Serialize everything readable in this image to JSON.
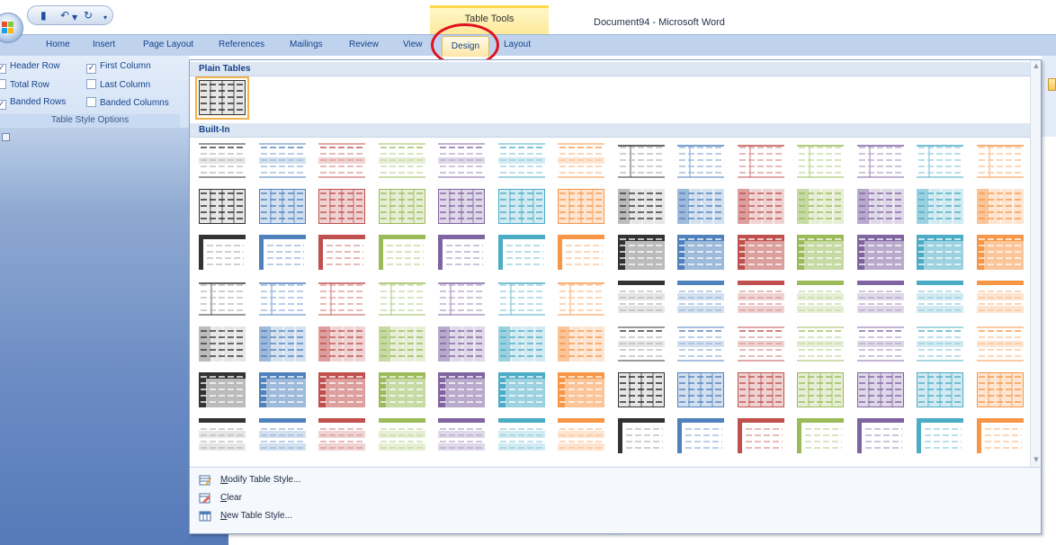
{
  "title_bar": {
    "contextual_group": "Table Tools",
    "document_title": "Document94 - Microsoft Word",
    "quick_access": {
      "save_icon": "save-icon",
      "undo_icon": "undo-icon",
      "redo_icon": "redo-icon",
      "customize_icon": "customize-qat-icon"
    }
  },
  "tabs": [
    "Home",
    "Insert",
    "Page Layout",
    "References",
    "Mailings",
    "Review",
    "View",
    "Design",
    "Layout"
  ],
  "active_tab": "Design",
  "table_style_options": {
    "group_label": "Table Style Options",
    "options": [
      {
        "label": "Header Row",
        "checked": true
      },
      {
        "label": "First Column",
        "checked": true
      },
      {
        "label": "Total Row",
        "checked": false
      },
      {
        "label": "Last Column",
        "checked": false
      },
      {
        "label": "Banded Rows",
        "checked": true
      },
      {
        "label": "Banded Columns",
        "checked": false
      }
    ]
  },
  "gallery": {
    "sections": [
      "Plain Tables",
      "Built-In"
    ],
    "accent_colors": [
      "#000000",
      "#4f81bd",
      "#c0504d",
      "#9bbb59",
      "#8064a2",
      "#4bacc6",
      "#f79646"
    ],
    "menu": {
      "modify": {
        "pre": "",
        "key": "M",
        "post": "odify Table Style..."
      },
      "clear": {
        "pre": "",
        "key": "C",
        "post": "lear"
      },
      "new": {
        "pre": "",
        "key": "N",
        "post": "ew Table Style..."
      }
    },
    "resize_grip": "....."
  },
  "colors": {
    "ribbon_bg": "#dfe8f6",
    "tab_row_bg": "#bfd3ee",
    "highlight_circle": "#e0121f"
  }
}
